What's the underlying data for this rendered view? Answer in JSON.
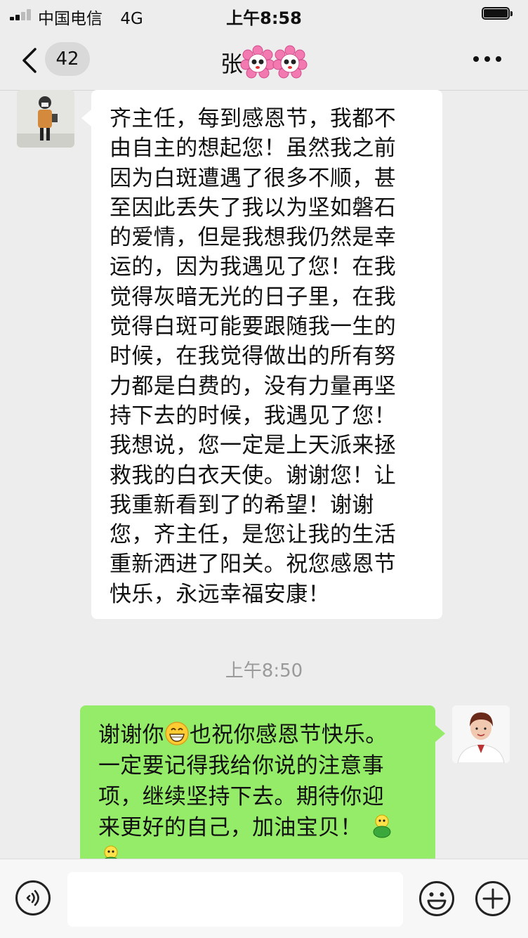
{
  "status_bar": {
    "carrier": "中国电信",
    "network": "4G",
    "time": "上午8:58"
  },
  "nav": {
    "unread_count": "42",
    "chat_title": "张"
  },
  "messages": [
    {
      "sender": "contact",
      "lines": [
        "齐主任，每到感恩节，我都不",
        "由自主的想起您！虽然我之前",
        "因为白斑遭遇了很多不顺，甚",
        "至因此丢失了我以为坚如磐石",
        "的爱情，但是我想我仍然是幸",
        "运的，因为我遇见了您！在我",
        "觉得灰暗无光的日子里，在我",
        "觉得白斑可能要跟随我一生的",
        "时候，在我觉得做出的所有努",
        "力都是白费的，没有力量再坚",
        "持下去的时候，我遇见了您！",
        "我想说，您一定是上天派来拯",
        "救我的白衣天使。谢谢您！让",
        "我重新看到了的希望！谢谢",
        "您，齐主任，是您让我的生活",
        "重新洒进了阳关。祝您感恩节",
        "快乐，永远幸福安康！"
      ]
    },
    {
      "sender": "me",
      "text_before_emoji": "谢谢你",
      "text_line1_rest": "也祝你感恩节快乐。",
      "line2": "一定要记得我给你说的注意事",
      "line3": "项，继续坚持下去。期待你迎",
      "line4": "来更好的自己，加油宝贝！"
    }
  ],
  "timestamp": "上午8:50",
  "input": {
    "value": ""
  },
  "icons": {
    "back": "chevron-left-icon",
    "more": "more-dots-icon",
    "voice": "voice-icon",
    "emoji": "emoji-icon",
    "plus": "plus-icon"
  },
  "colors": {
    "background": "#ededed",
    "my_bubble": "#95ec69",
    "contact_bubble": "#ffffff"
  }
}
